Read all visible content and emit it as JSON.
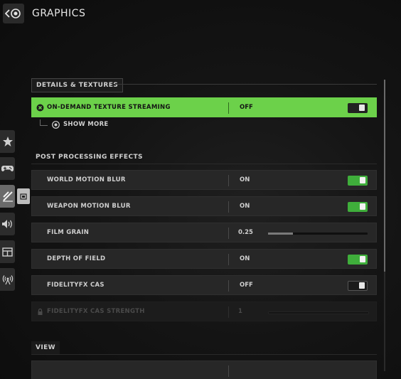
{
  "header": {
    "title": "GRAPHICS"
  },
  "sections": {
    "details": {
      "label": "DETAILS & TEXTURES"
    },
    "post": {
      "label": "POST PROCESSING EFFECTS"
    },
    "view": {
      "label": "VIEW"
    }
  },
  "rows": {
    "texture_streaming": {
      "label": "ON-DEMAND TEXTURE STREAMING",
      "value": "OFF",
      "toggle": "off"
    },
    "world_motion_blur": {
      "label": "WORLD MOTION BLUR",
      "value": "ON",
      "toggle": "on"
    },
    "weapon_motion_blur": {
      "label": "WEAPON MOTION BLUR",
      "value": "ON",
      "toggle": "on"
    },
    "film_grain": {
      "label": "FILM GRAIN",
      "value": "0.25",
      "slider_fraction": 0.25
    },
    "depth_of_field": {
      "label": "DEPTH OF FIELD",
      "value": "ON",
      "toggle": "on"
    },
    "fidelityfx_cas": {
      "label": "FIDELITYFX CAS",
      "value": "OFF",
      "toggle": "off"
    },
    "fidelityfx_cas_strength": {
      "label": "FIDELITYFX CAS STRENGTH",
      "value": "1",
      "disabled": true
    }
  },
  "show_more": {
    "label": "SHOW MORE"
  },
  "sidebar": {
    "items": [
      {
        "name": "favorites",
        "icon": "star-icon"
      },
      {
        "name": "controller",
        "icon": "gamepad-icon"
      },
      {
        "name": "graphics",
        "icon": "graphics-icon",
        "active": true
      },
      {
        "name": "audio",
        "icon": "speaker-icon"
      },
      {
        "name": "interface",
        "icon": "layout-icon"
      },
      {
        "name": "network",
        "icon": "broadcast-icon"
      }
    ]
  },
  "colors": {
    "accent": "#6cd14a",
    "toggle_on": "#3fae3b"
  }
}
